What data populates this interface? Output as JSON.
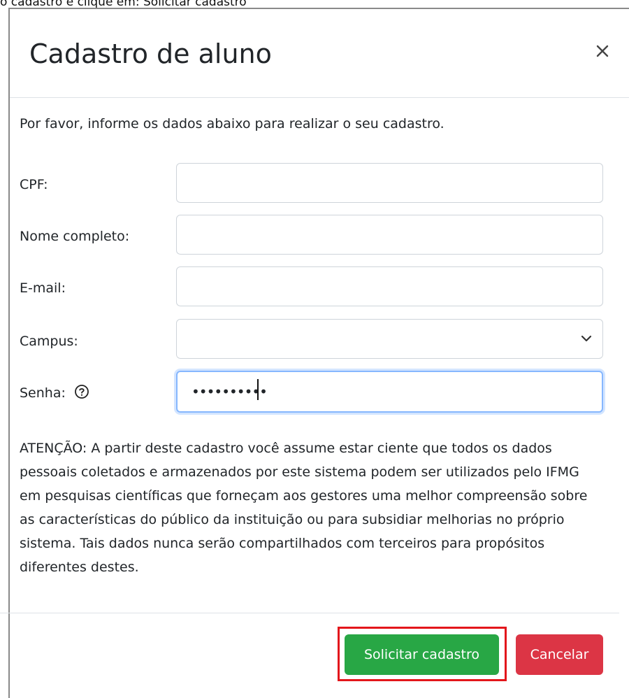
{
  "caption": "o cadastro e clique em: Solicitar cadastro",
  "modal": {
    "title": "Cadastro de aluno",
    "close_label": "×",
    "intro": "Por favor, informe os dados abaixo para realizar o seu cadastro."
  },
  "form": {
    "cpf": {
      "label": "CPF:",
      "value": ""
    },
    "nome": {
      "label": "Nome completo:",
      "value": ""
    },
    "email": {
      "label": "E-mail:",
      "value": ""
    },
    "campus": {
      "label": "Campus:",
      "selected": ""
    },
    "senha": {
      "label": "Senha:",
      "masked_value": "••••••••••",
      "help_icon": "question-circle-icon"
    }
  },
  "notice": "ATENÇÃO: A partir deste cadastro você assume estar ciente que todos os dados pessoais coletados e armazenados por este sistema podem ser utilizados pelo IFMG em pesquisas científicas que forneçam aos gestores uma melhor compreensão sobre as características do público da instituição ou para subsidiar melhorias no próprio sistema. Tais dados nunca serão compartilhados com terceiros para propósitos diferentes destes.",
  "footer": {
    "submit_label": "Solicitar cadastro",
    "cancel_label": "Cancelar"
  },
  "colors": {
    "success": "#28a745",
    "danger": "#dc3545",
    "highlight": "#e3161b",
    "focus": "#86b7fe"
  }
}
